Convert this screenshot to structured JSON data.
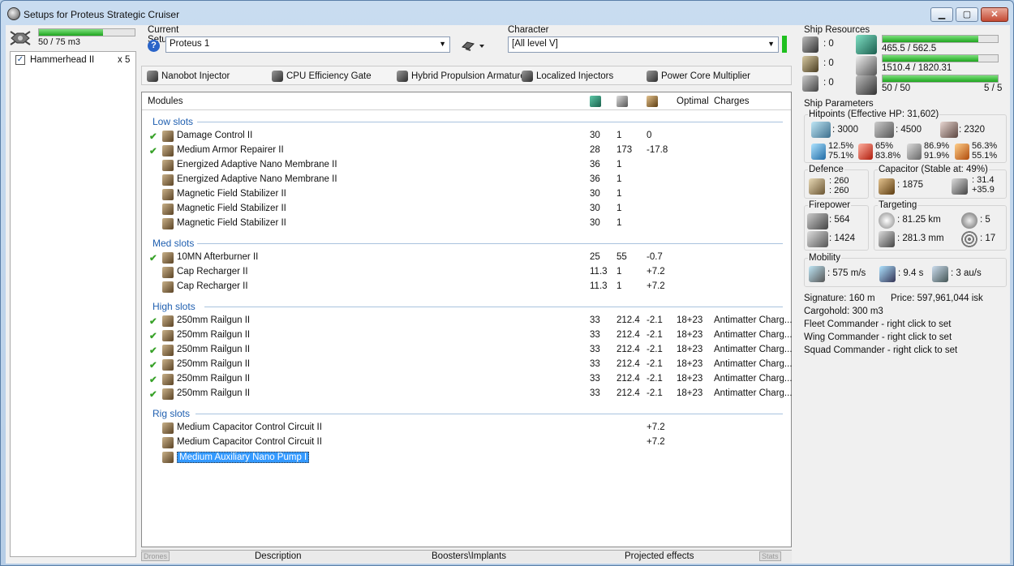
{
  "window": {
    "title": "Setups for Proteus Strategic Cruiser",
    "btn_min": "▁",
    "btn_max": "▢",
    "btn_close": "✕"
  },
  "drones": {
    "bay": "50 / 75 m3",
    "bay_fill": 0.67,
    "items": [
      {
        "name": "Hammerhead II",
        "count": "x 5",
        "checked": true
      }
    ]
  },
  "current_setup": {
    "label": "Current Setup",
    "value": "Proteus 1"
  },
  "character": {
    "label": "Character",
    "value": "[All level V]"
  },
  "boosters": [
    "Nanobot Injector",
    "CPU Efficiency Gate",
    "Hybrid Propulsion Armature",
    "Localized Injectors",
    "Power Core Multiplier"
  ],
  "modules_header": {
    "modules": "Modules",
    "optimal": "Optimal",
    "charges": "Charges"
  },
  "sections": {
    "low": {
      "title": "Low slots",
      "rows": [
        {
          "check": "✔",
          "name": "Damage Control II",
          "cpu": "30",
          "pg": "1",
          "cap": "0",
          "opt": "",
          "charge": ""
        },
        {
          "check": "✔",
          "name": "Medium Armor Repairer II",
          "cpu": "28",
          "pg": "173",
          "cap": "-17.8",
          "opt": "",
          "charge": ""
        },
        {
          "check": "",
          "name": "Energized Adaptive Nano Membrane II",
          "cpu": "36",
          "pg": "1",
          "cap": "",
          "opt": "",
          "charge": ""
        },
        {
          "check": "",
          "name": "Energized Adaptive Nano Membrane II",
          "cpu": "36",
          "pg": "1",
          "cap": "",
          "opt": "",
          "charge": ""
        },
        {
          "check": "",
          "name": "Magnetic Field Stabilizer II",
          "cpu": "30",
          "pg": "1",
          "cap": "",
          "opt": "",
          "charge": ""
        },
        {
          "check": "",
          "name": "Magnetic Field Stabilizer II",
          "cpu": "30",
          "pg": "1",
          "cap": "",
          "opt": "",
          "charge": ""
        },
        {
          "check": "",
          "name": "Magnetic Field Stabilizer II",
          "cpu": "30",
          "pg": "1",
          "cap": "",
          "opt": "",
          "charge": ""
        }
      ]
    },
    "med": {
      "title": "Med slots",
      "rows": [
        {
          "check": "✔",
          "name": "10MN Afterburner II",
          "cpu": "25",
          "pg": "55",
          "cap": "-0.7",
          "opt": "",
          "charge": ""
        },
        {
          "check": "",
          "name": "Cap Recharger II",
          "cpu": "11.3",
          "pg": "1",
          "cap": "+7.2",
          "opt": "",
          "charge": ""
        },
        {
          "check": "",
          "name": "Cap Recharger II",
          "cpu": "11.3",
          "pg": "1",
          "cap": "+7.2",
          "opt": "",
          "charge": ""
        }
      ]
    },
    "high": {
      "title": "High slots",
      "rows": [
        {
          "check": "✔",
          "name": "250mm Railgun II",
          "cpu": "33",
          "pg": "212.4",
          "cap": "-2.1",
          "opt": "18+23",
          "charge": "Antimatter Charg..."
        },
        {
          "check": "✔",
          "name": "250mm Railgun II",
          "cpu": "33",
          "pg": "212.4",
          "cap": "-2.1",
          "opt": "18+23",
          "charge": "Antimatter Charg..."
        },
        {
          "check": "✔",
          "name": "250mm Railgun II",
          "cpu": "33",
          "pg": "212.4",
          "cap": "-2.1",
          "opt": "18+23",
          "charge": "Antimatter Charg..."
        },
        {
          "check": "✔",
          "name": "250mm Railgun II",
          "cpu": "33",
          "pg": "212.4",
          "cap": "-2.1",
          "opt": "18+23",
          "charge": "Antimatter Charg..."
        },
        {
          "check": "✔",
          "name": "250mm Railgun II",
          "cpu": "33",
          "pg": "212.4",
          "cap": "-2.1",
          "opt": "18+23",
          "charge": "Antimatter Charg..."
        },
        {
          "check": "✔",
          "name": "250mm Railgun II",
          "cpu": "33",
          "pg": "212.4",
          "cap": "-2.1",
          "opt": "18+23",
          "charge": "Antimatter Charg..."
        }
      ]
    },
    "rig": {
      "title": "Rig slots",
      "rows": [
        {
          "check": "",
          "name": "Medium Capacitor Control Circuit II",
          "cpu": "",
          "pg": "",
          "cap": "+7.2",
          "opt": "",
          "charge": ""
        },
        {
          "check": "",
          "name": "Medium Capacitor Control Circuit II",
          "cpu": "",
          "pg": "",
          "cap": "+7.2",
          "opt": "",
          "charge": ""
        },
        {
          "check": "",
          "name": "Medium Auxiliary Nano Pump I",
          "cpu": "",
          "pg": "",
          "cap": "",
          "opt": "",
          "charge": "",
          "selected": true
        }
      ]
    }
  },
  "bottom_tabs": {
    "drones": "Drones",
    "description": "Description",
    "boosters": "Boosters\\Implants",
    "projected": "Projected effects",
    "stats": "Stats"
  },
  "resources": {
    "title": "Ship Resources",
    "hardpoints": [
      ": 0",
      ": 0",
      ": 0"
    ],
    "cpu": "465.5 / 562.5",
    "cpu_fill": 0.83,
    "pg": "1510.4 / 1820.31",
    "pg_fill": 0.83,
    "calib": "50 / 50",
    "calib_fill": 1.0,
    "rigs": "5 / 5"
  },
  "params": {
    "title": "Ship Parameters",
    "hp_title": "Hitpoints (Effective HP: 31,602)",
    "shield": ": 3000",
    "armor": ": 4500",
    "structure": ": 2320",
    "res": [
      [
        "12.5%",
        "75.1%"
      ],
      [
        "65%",
        "83.8%"
      ],
      [
        "86.9%",
        "91.9%"
      ],
      [
        "56.3%",
        "55.1%"
      ]
    ],
    "defence_title": "Defence",
    "defence": [
      ": 260",
      ": 260"
    ],
    "cap_title": "Capacitor (Stable at: 49%)",
    "cap": ": 1875",
    "cap_rate": [
      ": 31.4",
      "+35.9"
    ],
    "fire_title": "Firepower",
    "dps": ": 564",
    "volley": ": 1424",
    "target_title": "Targeting",
    "range": ": 81.25 km",
    "targets": ": 5",
    "scanres": ": 281.3 mm",
    "sensor": ": 17",
    "mob_title": "Mobility",
    "speed": ": 575 m/s",
    "align": ": 9.4 s",
    "warp": ": 3 au/s",
    "signature": "Signature: 160 m",
    "price": "Price: 597,961,044 isk",
    "cargo": "Cargohold: 300 m3",
    "fleet": "Fleet Commander - right click to set",
    "wing": "Wing Commander - right click to set",
    "squad": "Squad Commander - right click to set"
  },
  "colors": {
    "accent": "#1f5fb0",
    "check": "#39a22a",
    "bar": "#1fa51f",
    "selected": "#3399ff"
  }
}
